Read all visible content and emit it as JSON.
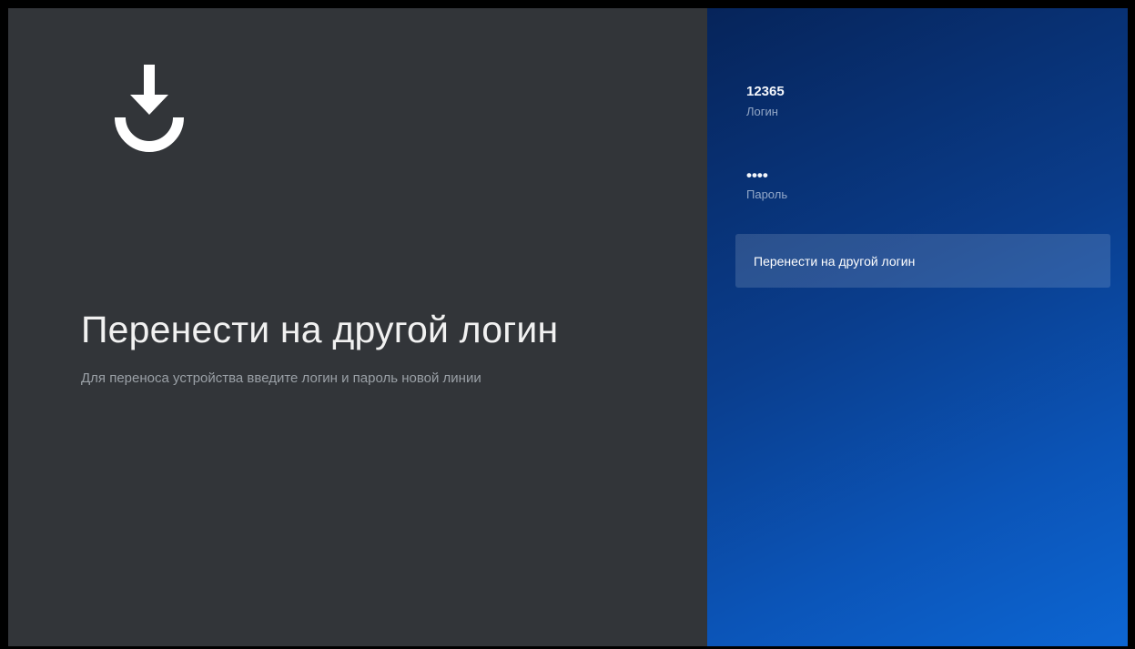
{
  "left": {
    "icon": "download-icon",
    "title": "Перенести на другой логин",
    "subtitle": "Для переноса устройства введите логин и пароль новой линии"
  },
  "right": {
    "login": {
      "value": "12365",
      "label": "Логин"
    },
    "password": {
      "value": "••••",
      "label": "Пароль"
    },
    "action": {
      "label": "Перенести на другой логин"
    }
  },
  "colors": {
    "left_background": "#323539",
    "right_gradient_start": "#06245a",
    "right_gradient_end": "#0d66d3",
    "button_highlight": "rgba(255,255,255,0.14)"
  }
}
